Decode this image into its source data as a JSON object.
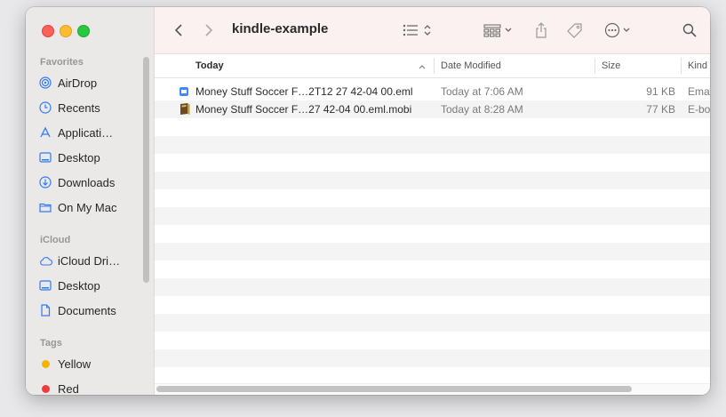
{
  "window": {
    "title": "kindle-example"
  },
  "sidebar": {
    "favorites_label": "Favorites",
    "favorites": [
      {
        "label": "AirDrop",
        "icon": "airdrop-icon"
      },
      {
        "label": "Recents",
        "icon": "clock-icon"
      },
      {
        "label": "Applicati…",
        "icon": "applications-icon"
      },
      {
        "label": "Desktop",
        "icon": "desktop-icon"
      },
      {
        "label": "Downloads",
        "icon": "downloads-icon"
      },
      {
        "label": "On My Mac",
        "icon": "folder-icon"
      }
    ],
    "icloud_label": "iCloud",
    "icloud": [
      {
        "label": "iCloud Dri…",
        "icon": "cloud-icon"
      },
      {
        "label": "Desktop",
        "icon": "desktop-icon"
      },
      {
        "label": "Documents",
        "icon": "document-icon"
      }
    ],
    "tags_label": "Tags",
    "tags": [
      {
        "label": "Yellow",
        "color": "#f5b400"
      },
      {
        "label": "Red",
        "color": "#f23c3c"
      }
    ]
  },
  "table": {
    "columns": {
      "name": "Today",
      "date": "Date Modified",
      "size": "Size",
      "kind": "Kind"
    },
    "rows": [
      {
        "name": "Money Stuff Soccer F…2T12 27 42-04 00.eml",
        "date": "Today at 7:06 AM",
        "size": "91 KB",
        "kind": "Ema"
      },
      {
        "name": "Money Stuff Soccer F…27 42-04 00.eml.mobi",
        "date": "Today at 8:28 AM",
        "size": "77 KB",
        "kind": "E-bo"
      }
    ]
  },
  "colors": {
    "accent": "#2f7bf5",
    "toolbar_bg": "#fbf1f1",
    "sidebar_bg": "#ebe8e8"
  }
}
